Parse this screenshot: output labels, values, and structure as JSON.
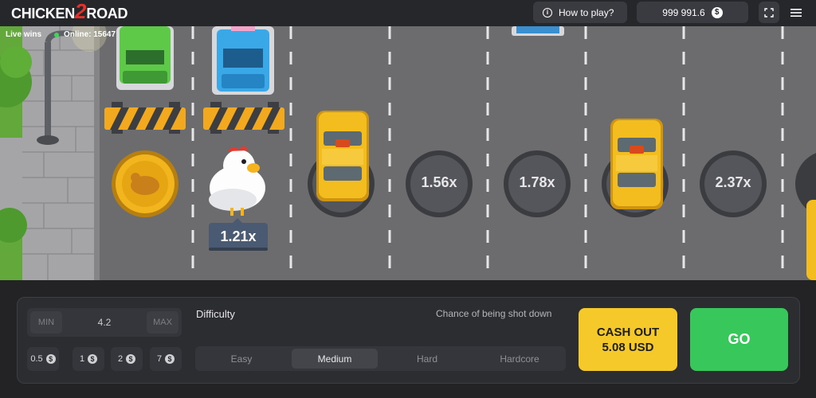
{
  "header": {
    "logo_word_1": "CHICKEN",
    "logo_number": "2",
    "logo_word_2": "ROAD",
    "how_to_play": "How to play?",
    "balance": "999 991.6",
    "currency_symbol": "$"
  },
  "live": {
    "label": "Live wins",
    "online": "Online: 15647"
  },
  "board": {
    "current_multiplier": "1.21x",
    "manholes": [
      "1.56x",
      "1.78x",
      "2.37x"
    ]
  },
  "controls": {
    "min_label": "MIN",
    "max_label": "MAX",
    "bet_amount": "4.2",
    "quick_bets": [
      "0.5",
      "1",
      "2",
      "7"
    ],
    "difficulty_label": "Difficulty",
    "chance_label": "Chance of being shot down",
    "difficulties": [
      {
        "label": "Easy",
        "active": false
      },
      {
        "label": "Medium",
        "active": true
      },
      {
        "label": "Hard",
        "active": false
      },
      {
        "label": "Hardcore",
        "active": false
      }
    ],
    "cashout_line1": "CASH OUT",
    "cashout_line2": "5.08 USD",
    "go_label": "GO"
  },
  "colors": {
    "road": "#6c6c6e",
    "cashout": "#f5c92a",
    "go": "#38c75a",
    "logo_number": "#e8302b",
    "taxi": "#f4bd1f"
  }
}
